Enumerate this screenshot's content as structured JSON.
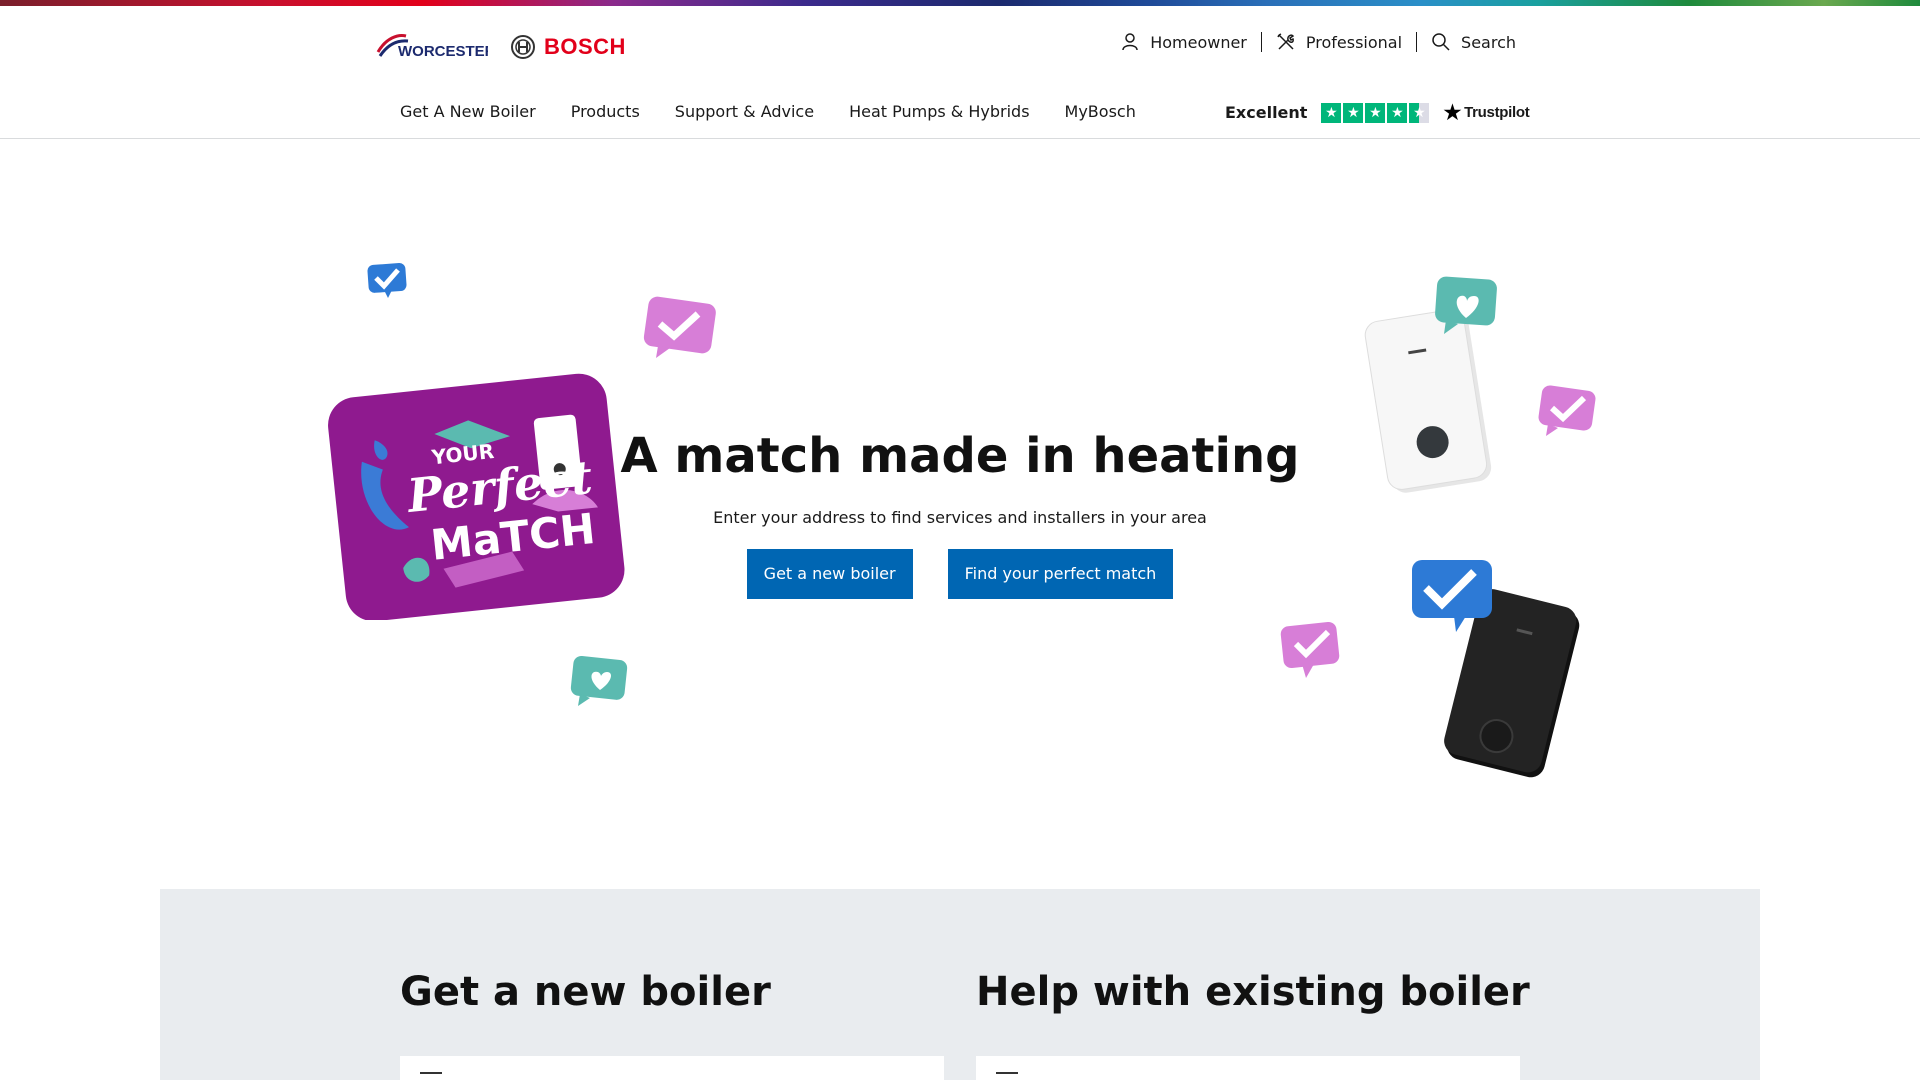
{
  "header": {
    "brand_worcester": "WORCESTER",
    "brand_bosch": "BOSCH",
    "utility": {
      "homeowner": "Homeowner",
      "professional": "Professional",
      "search": "Search"
    },
    "nav": [
      "Get A New Boiler",
      "Products",
      "Support & Advice",
      "Heat Pumps & Hybrids",
      "MyBosch"
    ],
    "trustpilot": {
      "rating_text": "Excellent",
      "stars": 4.5,
      "brand": "Trustpilot"
    }
  },
  "hero": {
    "title": "A match made in heating",
    "subtitle": "Enter your address to find services and installers in your area",
    "primary_button": "Get a new boiler",
    "secondary_button": "Find your perfect match",
    "badge_text_line1": "YOUR",
    "badge_text_line2": "Perfect",
    "badge_text_line3": "MaTCH"
  },
  "sections": {
    "new_boiler_title": "Get a new boiler",
    "existing_boiler_title": "Help with existing boiler"
  },
  "colors": {
    "accent_blue": "#0066b3",
    "bosch_red": "#e2001a",
    "trustpilot_green": "#00b67a",
    "badge_purple": "#8f1a8f",
    "panel_grey": "#e9ecef"
  }
}
